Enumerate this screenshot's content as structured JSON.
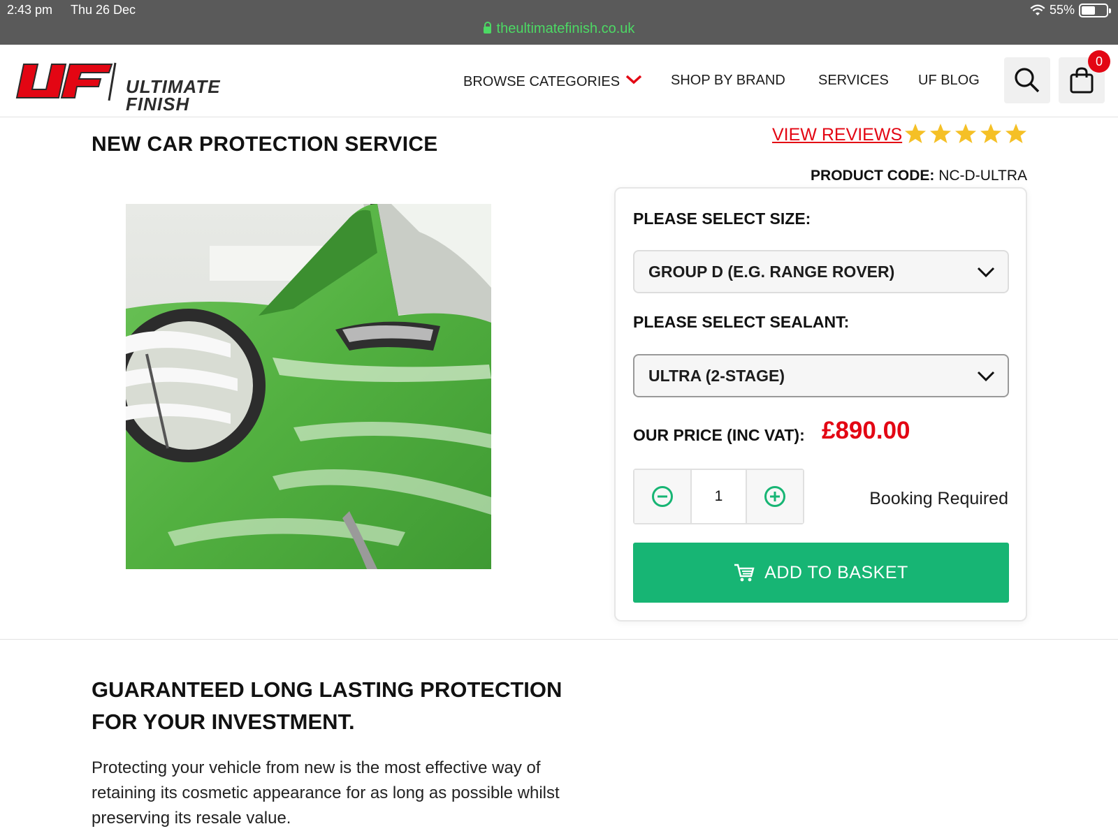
{
  "status_bar": {
    "time": "2:43 pm",
    "date": "Thu 26 Dec",
    "battery": "55%",
    "battery_level": 0.55,
    "url": "theultimatefinish.co.uk"
  },
  "header": {
    "logo_line1": "ULTIMATE",
    "logo_line2": "FINISH",
    "nav": {
      "browse": "BROWSE CATEGORIES",
      "brand": "SHOP BY BRAND",
      "services": "SERVICES",
      "blog": "UF BLOG"
    },
    "cart_count": "0"
  },
  "product": {
    "title": "NEW CAR PROTECTION SERVICE",
    "view_reviews": "VIEW REVIEWS",
    "rating": 5,
    "code_label": "PRODUCT CODE:",
    "code_value": "NC-D-ULTRA",
    "size_label": "PLEASE SELECT SIZE:",
    "size_value": "GROUP D (E.G. RANGE ROVER)",
    "sealant_label": "PLEASE SELECT SEALANT:",
    "sealant_value": "ULTRA (2-STAGE)",
    "price_label": "OUR PRICE (INC VAT):",
    "price_value": "£890.00",
    "quantity": "1",
    "booking": "Booking Required",
    "add_to_basket": "ADD TO BASKET"
  },
  "content": {
    "heading": "GUARANTEED LONG LASTING PROTECTION FOR YOUR INVESTMENT.",
    "body": "Protecting your vehicle from new is the most effective way of retaining its cosmetic appearance for as long as possible whilst preserving its resale value."
  },
  "colors": {
    "accent_red": "#e30613",
    "accent_green": "#17b574",
    "star_yellow": "#f5c026"
  }
}
